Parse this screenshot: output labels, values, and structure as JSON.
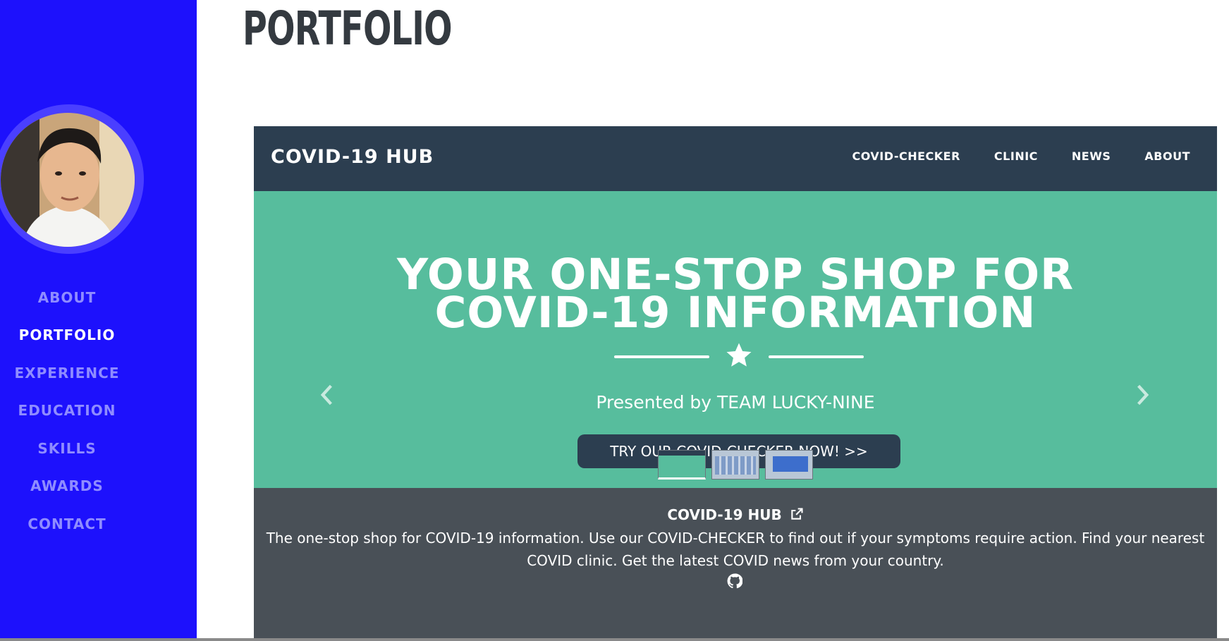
{
  "sidebar": {
    "bg_color": "#1d11fc",
    "avatar_alt": "profile photo",
    "nav": [
      {
        "label": "ABOUT",
        "active": false
      },
      {
        "label": "PORTFOLIO",
        "active": true
      },
      {
        "label": "EXPERIENCE",
        "active": false
      },
      {
        "label": "EDUCATION",
        "active": false
      },
      {
        "label": "SKILLS",
        "active": false
      },
      {
        "label": "AWARDS",
        "active": false
      },
      {
        "label": "CONTACT",
        "active": false
      }
    ]
  },
  "main": {
    "title": "PORTFOLIO"
  },
  "project": {
    "site": {
      "brand": "COVID-19 HUB",
      "menu": [
        "COVID-CHECKER",
        "CLINIC",
        "NEWS",
        "ABOUT"
      ],
      "hero_title_line1": "YOUR ONE-STOP SHOP FOR",
      "hero_title_line2": "COVID-19 INFORMATION",
      "presented": "Presented by TEAM LUCKY-NINE",
      "cta": "TRY OUR COVID-CHECKER NOW! >>",
      "hero_color": "#57bd9d",
      "nav_color": "#2c3e50"
    },
    "carousel": {
      "prev_icon": "chevron-left-icon",
      "next_icon": "chevron-right-icon",
      "thumbnail_count": 3,
      "active_index": 0
    },
    "title": "COVID-19 HUB",
    "title_icon": "external-link-icon",
    "description": "The one-stop shop for COVID-19 information. Use our COVID-CHECKER to find out if your symptoms require action. Find your nearest COVID clinic. Get the latest COVID news from your country.",
    "repo_icon": "github-icon"
  }
}
